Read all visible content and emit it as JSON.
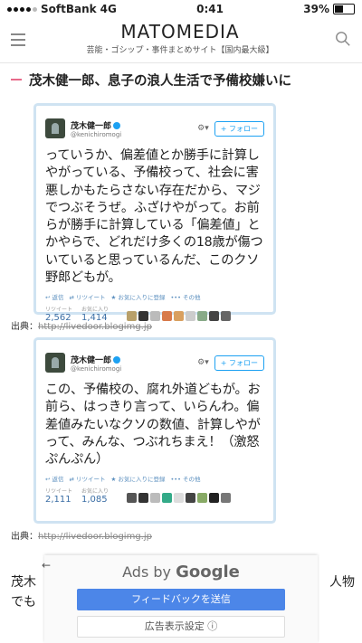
{
  "status": {
    "carrier": "SoftBank",
    "network": "4G",
    "time": "0:41",
    "battery": "39%",
    "battery_level": 0.39
  },
  "header": {
    "logo": "MATOMEDIA",
    "tagline": "芸能・ゴシップ・事件まとめサイト【国内最大級】"
  },
  "article": {
    "title": "茂木健一郎、息子の浪人生活で予備校嫌いに"
  },
  "tweets": [
    {
      "name": "茂木健一郎",
      "handle": "@kenichiromogi",
      "follow": "フォロー",
      "text": "っていうか、偏差値とか勝手に計算しやがっている、予備校って、社会に害悪しかもたらさない存在だから、マジでつぶそうぜ。ふざけやがって。お前らが勝手に計算している「偏差値」とかやらで、どれだけ多くの18歳が傷ついていると思っているんだ、このクソ野郎どもが。",
      "actions": [
        "返信",
        "リツイート",
        "お気に入りに登録",
        "その他"
      ],
      "retweets_label": "リツイート",
      "retweets": "2,562",
      "likes_label": "お気に入り",
      "likes": "1,414",
      "source_label": "出典：",
      "source_url": "http://livedoor.blogimg.jp"
    },
    {
      "name": "茂木健一郎",
      "handle": "@kenichiromogi",
      "follow": "フォロー",
      "text": "この、予備校の、腐れ外道どもが。お前ら、はっきり言って、いらんわ。偏差値みたいなクソの数値、計算しやがって、みんな、つぶれちまえ！（激怒ぷんぷん）",
      "actions": [
        "返信",
        "リツイート",
        "お気に入りに登録",
        "その他"
      ],
      "retweets_label": "リツイート",
      "retweets": "2,111",
      "likes_label": "お気に入り",
      "likes": "1,085",
      "source_label": "出典：",
      "source_url": "http://livedoor.blogimg.jp"
    }
  ],
  "body_text": {
    "line1": "茂木",
    "line2": "でも",
    "line1_right": "人物"
  },
  "ad": {
    "title_prefix": "Ads by",
    "title_brand": "Google",
    "feedback_button": "フィードバックを送信",
    "settings_button": "広告表示設定 ⓘ"
  }
}
